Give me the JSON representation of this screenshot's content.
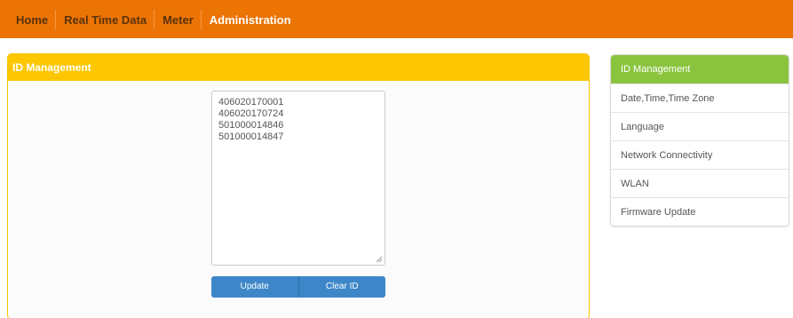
{
  "nav": {
    "items": [
      {
        "label": "Home"
      },
      {
        "label": "Real Time Data"
      },
      {
        "label": "Meter"
      },
      {
        "label": "Administration"
      }
    ],
    "active": "Administration"
  },
  "panel": {
    "title": "ID Management",
    "ids": [
      "406020170001",
      "406020170724",
      "501000014846",
      "501000014847"
    ],
    "update_label": "Update",
    "clear_label": "Clear ID"
  },
  "sidebar": {
    "items": [
      {
        "label": "ID Management"
      },
      {
        "label": "Date,Time,Time Zone"
      },
      {
        "label": "Language"
      },
      {
        "label": "Network Connectivity"
      },
      {
        "label": "WLAN"
      },
      {
        "label": "Firmware Update"
      }
    ],
    "active": "ID Management"
  },
  "colors": {
    "nav_bg": "#ec7405",
    "panel_header": "#fcc600",
    "button": "#3d87c9",
    "sidebar_active": "#8ac43f"
  }
}
